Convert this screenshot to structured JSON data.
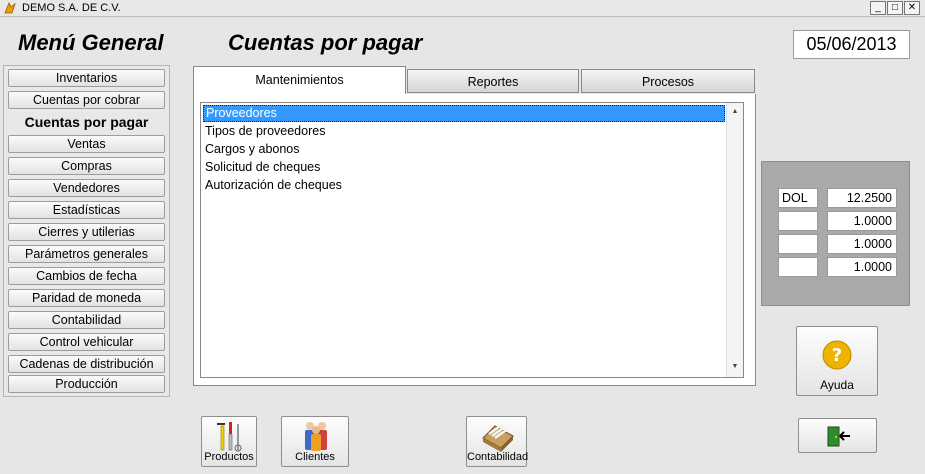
{
  "window": {
    "title": "DEMO  S.A. DE C.V.",
    "minimize": "_",
    "maximize": "□",
    "close": "✕"
  },
  "header": {
    "menu_title": "Menú General",
    "section_title": "Cuentas por pagar",
    "date": "05/06/2013"
  },
  "menu": {
    "items": [
      "Inventarios",
      "Cuentas por cobrar",
      "Cuentas por pagar",
      "Ventas",
      "Compras",
      "Vendedores",
      "Estadísticas",
      "Cierres y utilerias",
      "Parámetros generales",
      "Cambios de fecha",
      "Paridad de moneda",
      "Contabilidad",
      "Control vehicular",
      "Cadenas de distribución",
      "Producción"
    ],
    "active": "Cuentas por pagar"
  },
  "tabs": [
    "Mantenimientos",
    "Reportes",
    "Procesos"
  ],
  "list": {
    "items": [
      "Proveedores",
      "Tipos de proveedores",
      "Cargos y abonos",
      "Solicitud de cheques",
      "Autorización de cheques"
    ],
    "selected": "Proveedores"
  },
  "currency": [
    {
      "code": "DOL",
      "rate": "12.2500"
    },
    {
      "code": "",
      "rate": "1.0000"
    },
    {
      "code": "",
      "rate": "1.0000"
    },
    {
      "code": "",
      "rate": "1.0000"
    }
  ],
  "buttons": {
    "help": "Ayuda",
    "products": "Productos",
    "clients": "Clientes",
    "accounting": "Contabilidad"
  },
  "icons": {
    "help": "question-icon",
    "exit": "exit-door-icon",
    "products": "tools-icon",
    "clients": "people-icon",
    "accounting": "card-file-icon",
    "app": "app-logo-icon"
  },
  "colors": {
    "selection": "#3399ff",
    "currency_panel": "#a9a9a9",
    "help_icon": "#f0b400"
  }
}
